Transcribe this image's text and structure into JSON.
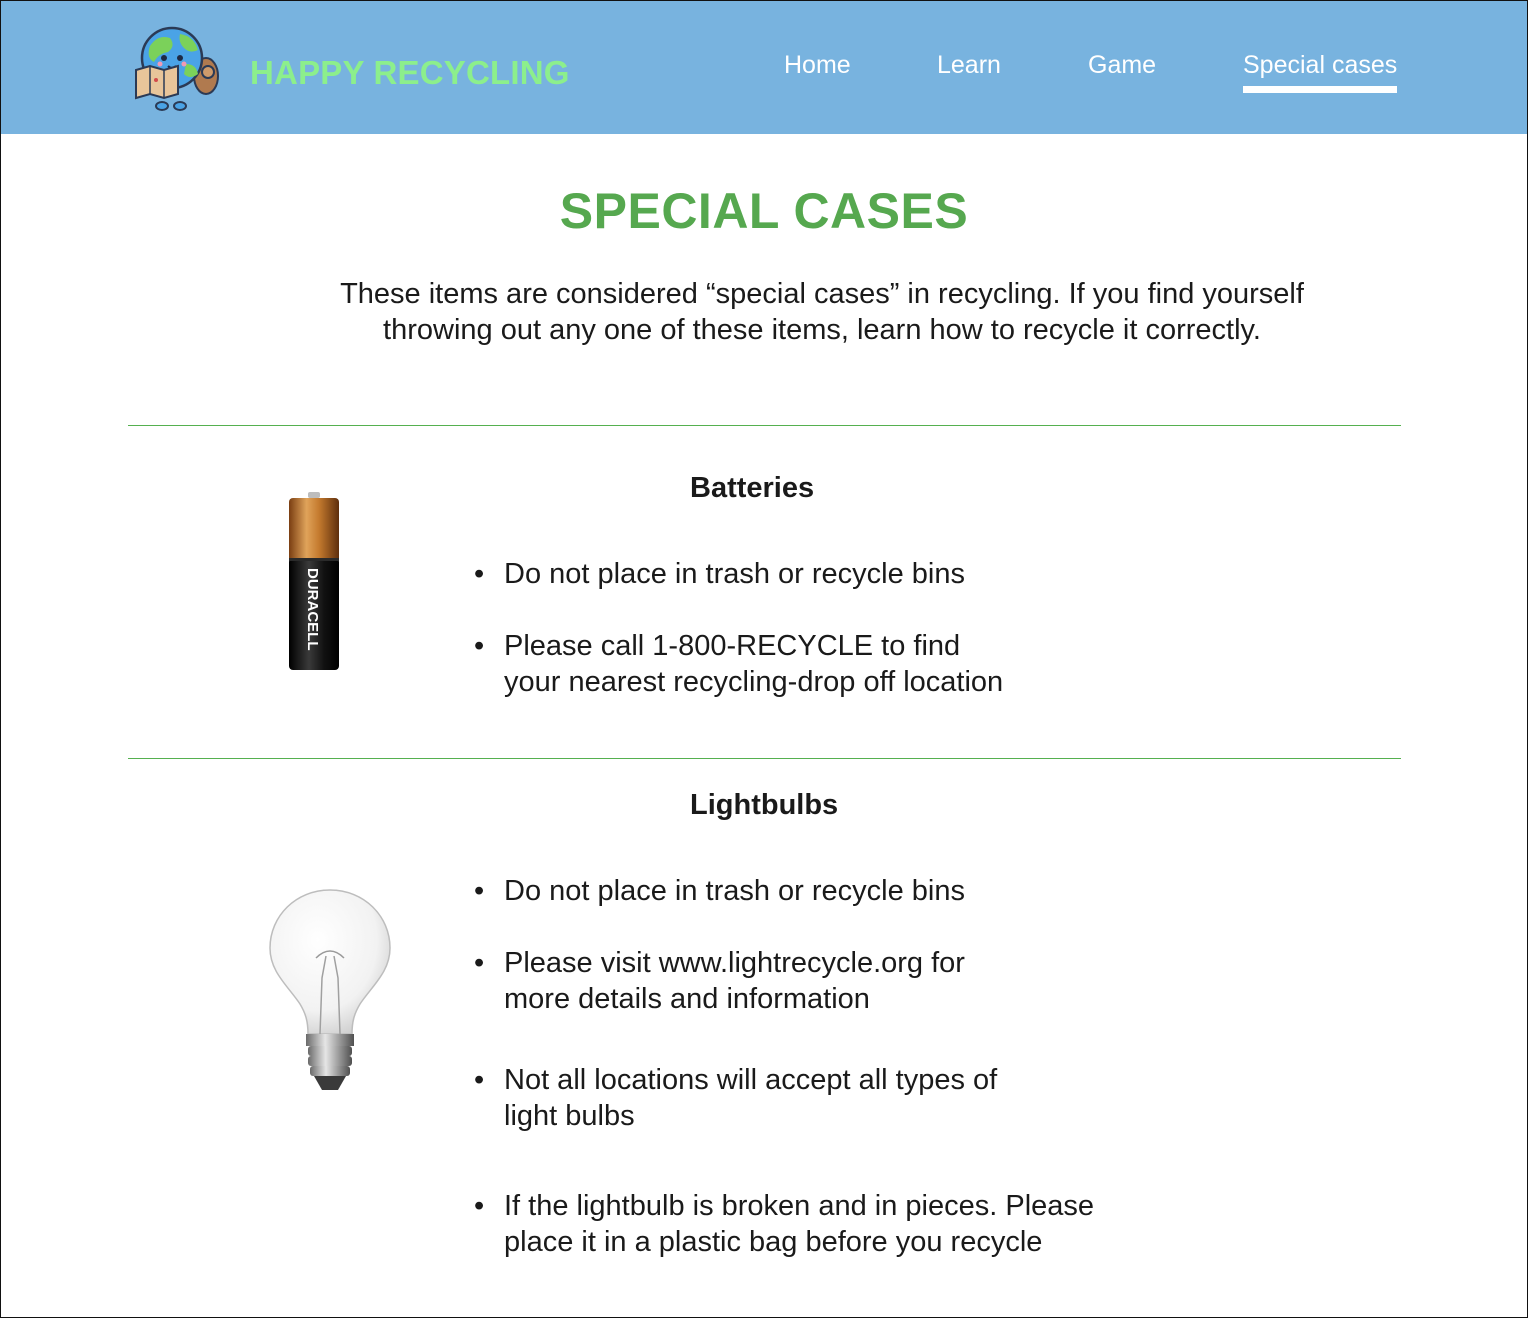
{
  "header": {
    "brand": "HAPPY RECYCLING",
    "nav": [
      {
        "label": "Home"
      },
      {
        "label": "Learn"
      },
      {
        "label": "Game"
      },
      {
        "label": "Special cases",
        "active": true
      }
    ],
    "logo_icon": "earth-mascot-with-map-icon"
  },
  "main": {
    "title": "SPECIAL CASES",
    "intro_line1": "These items are considered “special cases” in recycling. If you find yourself",
    "intro_line2": "throwing out any one of these items, learn how to recycle it correctly.",
    "sections": [
      {
        "title": "Batteries",
        "image_icon": "battery-icon",
        "image_text": "DURACELL",
        "bullets": [
          "Do not place in trash or recycle bins",
          "Please call 1-800-RECYCLE to find\nyour nearest recycling-drop off location"
        ]
      },
      {
        "title": "Lightbulbs",
        "image_icon": "lightbulb-icon",
        "bullets": [
          "Do not place in trash or recycle bins",
          "Please visit www.lightrecycle.org for\nmore details and information",
          "Not all locations will accept all types of\nlight bulbs",
          "If the lightbulb is broken and in pieces. Please\nplace it in a plastic bag before you recycle"
        ]
      }
    ]
  },
  "colors": {
    "header_bg": "#78b3df",
    "brand": "#8cef8c",
    "title": "#56a84f",
    "divider": "#55b04f"
  }
}
